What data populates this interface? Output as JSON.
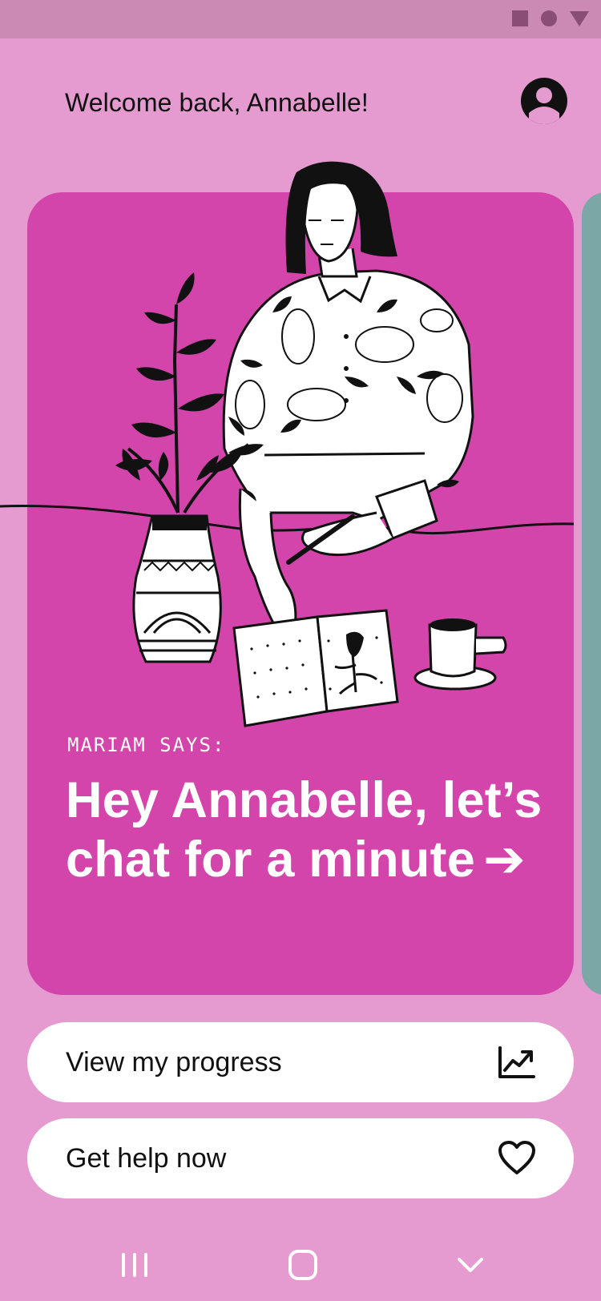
{
  "status_bar": {
    "icons": [
      "square-icon",
      "circle-icon",
      "triangle-icon"
    ]
  },
  "header": {
    "welcome_text": "Welcome back, Annabelle!",
    "avatar_icon": "user-avatar-icon"
  },
  "card": {
    "says_label": "MARIAM SAYS:",
    "headline": "Hey Annabelle, let’s chat for a minute",
    "arrow": "➔",
    "background_color": "#D345AA",
    "illustration": "woman-journaling-illustration"
  },
  "actions": [
    {
      "label": "View my progress",
      "icon": "trend-chart-icon"
    },
    {
      "label": "Get help now",
      "icon": "heart-icon"
    }
  ],
  "nav": {
    "items": [
      "recents-icon",
      "home-icon",
      "back-chevron-icon"
    ]
  },
  "colors": {
    "background": "#E59BD0",
    "status_bar": "#CB8AB3",
    "card": "#D345AA",
    "side_card": "#7BA7A6"
  }
}
